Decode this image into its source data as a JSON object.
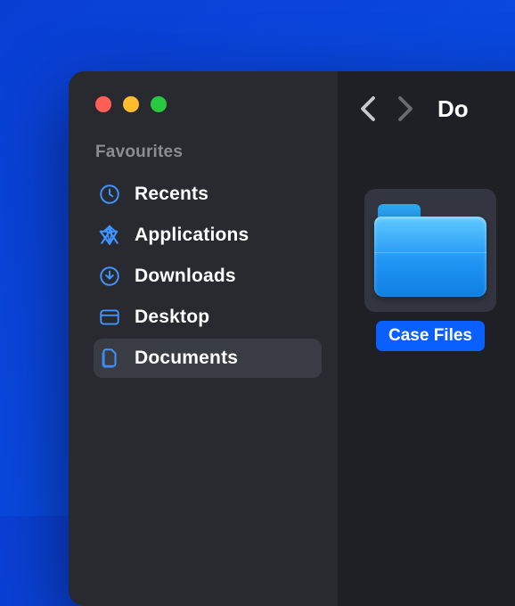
{
  "colors": {
    "accent_blue": "#3f95ff",
    "selection_blue": "#0a5fff",
    "sidebar_bg": "#282a30",
    "main_bg": "#1e2026"
  },
  "window": {
    "traffic_lights": {
      "close": "close",
      "minimize": "minimize",
      "maximize": "maximize"
    }
  },
  "sidebar": {
    "section_label": "Favourites",
    "items": [
      {
        "icon": "clock-icon",
        "label": "Recents",
        "active": false
      },
      {
        "icon": "applications-icon",
        "label": "Applications",
        "active": false
      },
      {
        "icon": "download-icon",
        "label": "Downloads",
        "active": false
      },
      {
        "icon": "desktop-icon",
        "label": "Desktop",
        "active": false
      },
      {
        "icon": "documents-icon",
        "label": "Documents",
        "active": true
      }
    ]
  },
  "toolbar": {
    "back": "Back",
    "forward": "Forward",
    "title": "Do"
  },
  "content": {
    "items": [
      {
        "type": "folder",
        "label": "Case Files",
        "selected": true
      }
    ]
  }
}
